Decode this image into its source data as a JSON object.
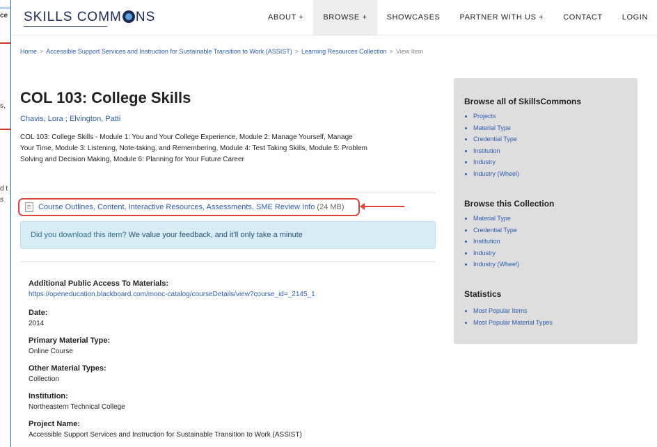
{
  "background_page": {
    "fragments": [
      "ce",
      "s,",
      "d t",
      "s"
    ]
  },
  "nav": {
    "logo_text": "SKILLS COMM",
    "logo_text_end": "NS",
    "items": [
      {
        "label": "ABOUT +"
      },
      {
        "label": "BROWSE +"
      },
      {
        "label": "SHOWCASES"
      },
      {
        "label": "PARTNER WITH US +"
      },
      {
        "label": "CONTACT"
      },
      {
        "label": "LOGIN"
      }
    ],
    "active_item": "BROWSE +"
  },
  "breadcrumb": {
    "home": "Home",
    "collection_parent": "Accessible Support Services and Instruction for Sustainable Transition to Work (ASSIST)",
    "collection": "Learning Resources Collection",
    "current": "View Item",
    "separator": ">"
  },
  "item": {
    "title": "COL 103: College Skills",
    "author_1": "Chavis, Lora",
    "author_sep": " ; ",
    "author_2": "Elvington, Patti",
    "abstract": "COL 103: College Skills - Module 1: You and Your College Experience, Module 2: Manage Yourself, Manage Your Time, Module 3: Listening, Note-taking, and Remembering, Module 4: Test Taking Skills, Module 5: Problem Solving and Decision Making, Module 6: Planning for Your Future Career",
    "file_link": "Course Outlines, Content, Interactive Resources, Assessments, SME Review Info",
    "file_size": "(24 MB)"
  },
  "feedback": {
    "question": "Did you download this item?",
    "link": "We value your feedback, and it'll only take a minute"
  },
  "metadata": [
    {
      "label": "Additional Public Access To Materials:",
      "value": "https://openeducation.blackboard.com/mooc-catalog/courseDetails/view?course_id=_2145_1",
      "is_link": true
    },
    {
      "label": "Date:",
      "value": "2014",
      "is_link": false
    },
    {
      "label": "Primary Material Type:",
      "value": "Online Course",
      "is_link": false
    },
    {
      "label": "Other Material Types:",
      "value": "Collection",
      "is_link": false
    },
    {
      "label": "Institution:",
      "value": "Northeastern Technical College",
      "is_link": false
    },
    {
      "label": "Project Name:",
      "value": "Accessible Support Services and Instruction for Sustainable Transition to Work (ASSIST)",
      "is_link": false
    }
  ],
  "sidebar": {
    "sections": [
      {
        "heading": "Browse all of SkillsCommons",
        "links": [
          "Projects",
          "Material Type",
          "Credential Type",
          "Institution",
          "Industry",
          "Industry (Wheel)"
        ]
      },
      {
        "heading": "Browse this Collection",
        "links": [
          "Material Type",
          "Credential Type",
          "Institution",
          "Industry",
          "Industry (Wheel)"
        ]
      },
      {
        "heading": "Statistics",
        "links": [
          "Most Popular Items",
          "Most Popular Material Types"
        ]
      }
    ]
  },
  "colors": {
    "link": "#2a5db0",
    "annotation_red": "#e0433a",
    "feedback_bg": "#d8ecf5",
    "sidebar_bg": "#dedede"
  }
}
